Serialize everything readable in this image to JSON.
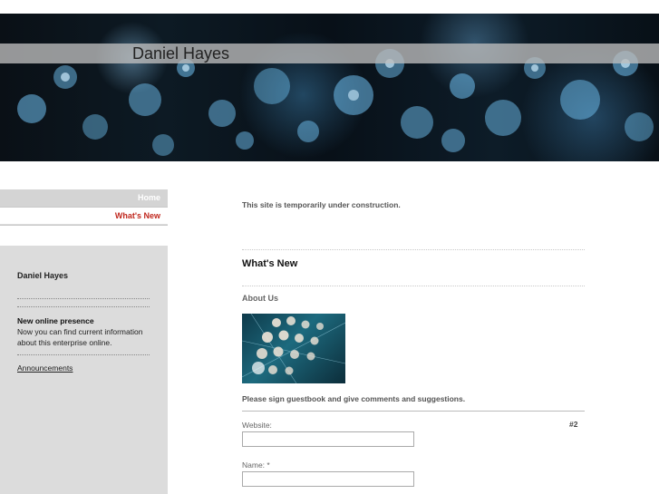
{
  "header": {
    "site_title": "Daniel Hayes"
  },
  "nav": {
    "items": [
      {
        "label": "Home"
      },
      {
        "label": "What's New"
      }
    ]
  },
  "sidebar": {
    "name": "Daniel Hayes",
    "news_title": "New online presence",
    "news_text": "Now you can find current information about this enterprise online.",
    "announcements_link": "Announcements"
  },
  "main": {
    "notice": "This site is temporarily under construction.",
    "section_title": "What's New",
    "about_title": "About Us",
    "guestbook_prompt": "Please sign guestbook and give comments and suggestions.",
    "entry_number": "#2",
    "form": {
      "website_label": "Website:",
      "website_value": "",
      "name_label": "Name: *",
      "name_value": ""
    }
  },
  "colors": {
    "accent_red": "#c0281e",
    "sidebar_bg": "#dcdcdc",
    "banner_dark": "#0a1016",
    "bokeh_blue": "#5fb4e6"
  }
}
